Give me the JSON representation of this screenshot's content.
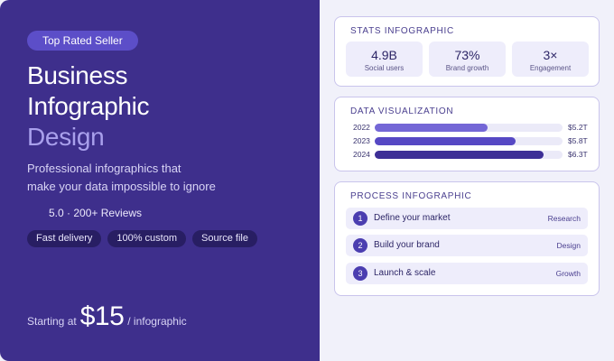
{
  "hero": {
    "badge": "Top Rated Seller",
    "title_line1": "Business",
    "title_line2": "Infographic",
    "title_line3": "Design",
    "subtitle_line1": "Professional infographics that",
    "subtitle_line2": "make your data impossible to ignore",
    "reviews": "5.0 · 200+ Reviews",
    "tags": [
      "Fast delivery",
      "100% custom",
      "Source file"
    ],
    "price_label": "Starting at",
    "price": "$15",
    "price_unit": "/ infographic"
  },
  "stats": {
    "header": "STATS INFOGRAPHIC",
    "items": [
      {
        "value": "4.9B",
        "label": "Social users"
      },
      {
        "value": "73%",
        "label": "Brand growth"
      },
      {
        "value": "3×",
        "label": "Engagement"
      }
    ]
  },
  "viz": {
    "header": "DATA VISUALIZATION",
    "bars": [
      {
        "year": "2022",
        "amount": "$5.2T",
        "fill_fraction": 0.6,
        "color": "#7467d6"
      },
      {
        "year": "2023",
        "amount": "$5.8T",
        "fill_fraction": 0.75,
        "color": "#5648c4"
      },
      {
        "year": "2024",
        "amount": "$6.3T",
        "fill_fraction": 0.9,
        "color": "#3d2f96"
      }
    ]
  },
  "process": {
    "header": "PROCESS INFOGRAPHIC",
    "steps": [
      {
        "num": "1",
        "label": "Define your market",
        "category": "Research"
      },
      {
        "num": "2",
        "label": "Build your brand",
        "category": "Design"
      },
      {
        "num": "3",
        "label": "Launch & scale",
        "category": "Growth"
      }
    ]
  },
  "colors": {
    "panel": "#3e2f8c",
    "badge": "#5c4ec8",
    "accent_text": "#a9a0ec",
    "tag": "#281e63",
    "card_border": "#c9c4ec"
  }
}
